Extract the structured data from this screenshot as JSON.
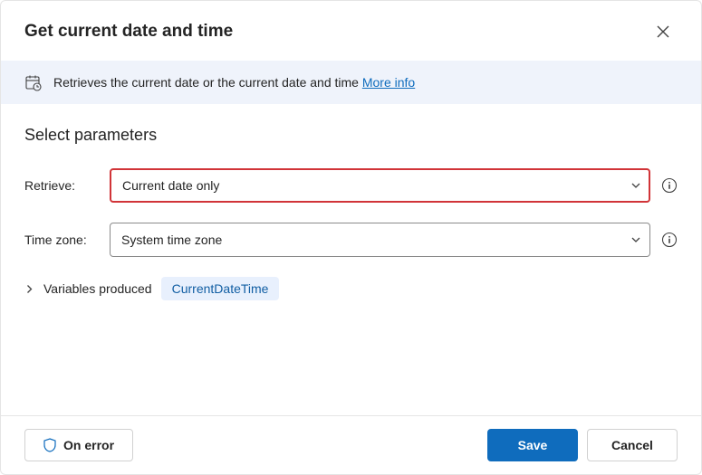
{
  "header": {
    "title": "Get current date and time"
  },
  "info": {
    "text": "Retrieves the current date or the current date and time ",
    "link": "More info"
  },
  "section": {
    "title": "Select parameters"
  },
  "fields": {
    "retrieve": {
      "label": "Retrieve:",
      "value": "Current date only"
    },
    "timezone": {
      "label": "Time zone:",
      "value": "System time zone"
    }
  },
  "vars": {
    "label": "Variables produced",
    "chip": "CurrentDateTime"
  },
  "footer": {
    "on_error": "On error",
    "save": "Save",
    "cancel": "Cancel"
  }
}
